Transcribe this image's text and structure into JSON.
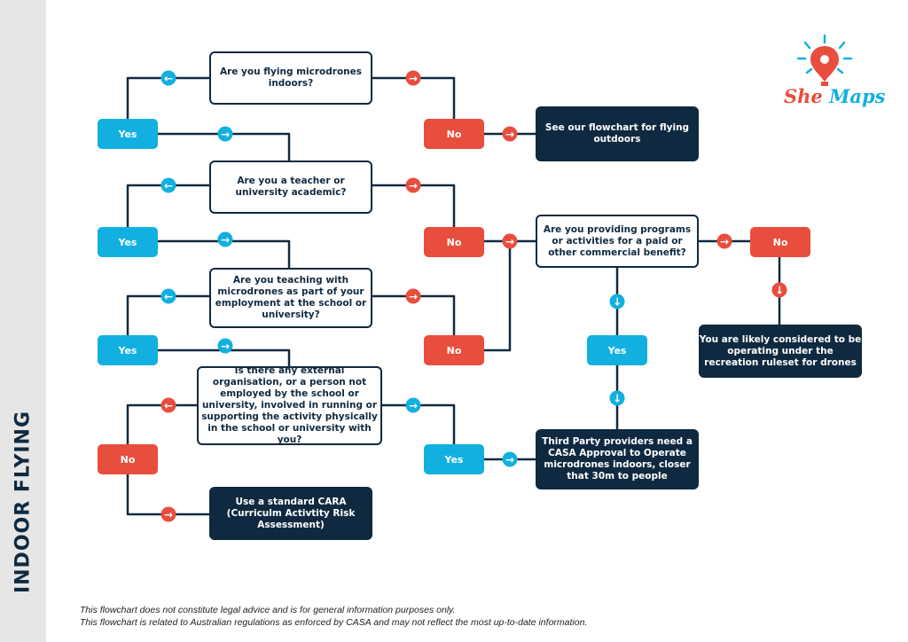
{
  "sidebar": {
    "title": "INDOOR FLYING"
  },
  "logo": {
    "part1": "She",
    "part2": "Maps",
    "icon": "lightbulb-map-pin-icon"
  },
  "colors": {
    "navy": "#0f2a40",
    "blue": "#12b0e0",
    "red": "#e84e3d",
    "sidebar_bg": "#e6e6e7"
  },
  "nodes": {
    "q1": "Are you flying microdrones indoors?",
    "q2": "Are you a teacher or university academic?",
    "q3": "Are you teaching with microdrones as part of your employment at the school or university?",
    "q4": "Is there any external organisation, or a person not employed by the school or university, involved in running or supporting the activity physically in the school or university with you?",
    "q5": "Are you providing programs or activities for a paid or other commercial benefit?",
    "r_outdoors": "See our flowchart for flying outdoors",
    "r_recreation": "You are likely considered to be operating under the recreation ruleset for drones",
    "r_casa": "Third Party providers need a CASA Approval to Operate microdrones indoors, closer that 30m to people",
    "r_cara": "Use a standard CARA (Curriculm Activtity Risk Assessment)",
    "yes": "Yes",
    "no": "No"
  },
  "footer": {
    "line1": "This flowchart does not constitute legal advice and is for general information purposes only.",
    "line2": "This flowchart is related to Australian regulations as enforced by CASA and may not reflect the most up-to-date information."
  }
}
